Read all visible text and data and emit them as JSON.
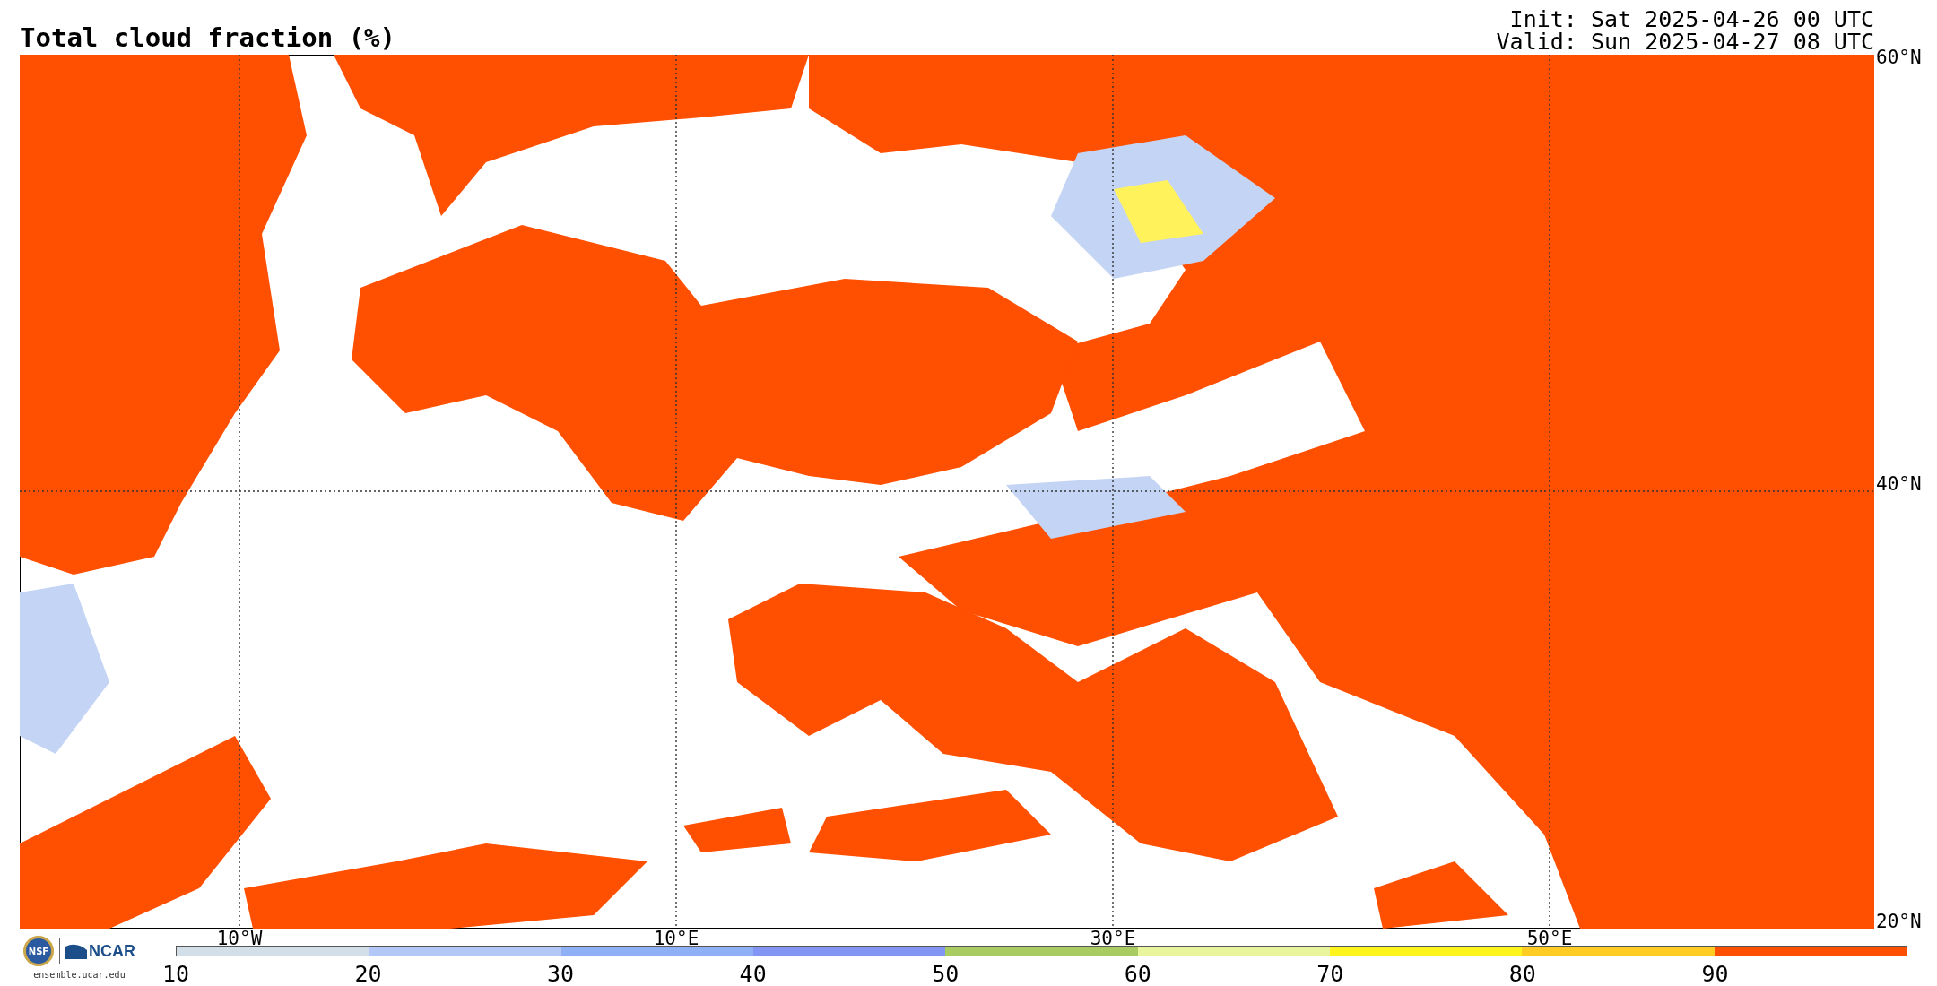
{
  "header": {
    "title": "Total cloud fraction (%)",
    "init": "Init: Sat 2025-04-26 00 UTC",
    "valid": "Valid: Sun 2025-04-27 08 UTC"
  },
  "map": {
    "lat_labels": [
      "60°N",
      "40°N",
      "20°N"
    ],
    "lon_labels": [
      "10°W",
      "10°E",
      "30°E",
      "50°E"
    ]
  },
  "logos": {
    "nsf": "NSF",
    "ncar": "NCAR",
    "url": "ensemble.ucar.edu"
  },
  "colorbar": {
    "bins": [
      {
        "color": "#d3dfe8"
      },
      {
        "color": "#b4c8f8"
      },
      {
        "color": "#90b0f5"
      },
      {
        "color": "#8294f4"
      },
      {
        "color": "#a8cc62"
      },
      {
        "color": "#e8f59c"
      },
      {
        "color": "#fff51c"
      },
      {
        "color": "#ffcc24"
      },
      {
        "color": "#ff4f00"
      }
    ],
    "ticks": [
      "10",
      "20",
      "30",
      "40",
      "50",
      "60",
      "70",
      "80",
      "90"
    ]
  }
}
